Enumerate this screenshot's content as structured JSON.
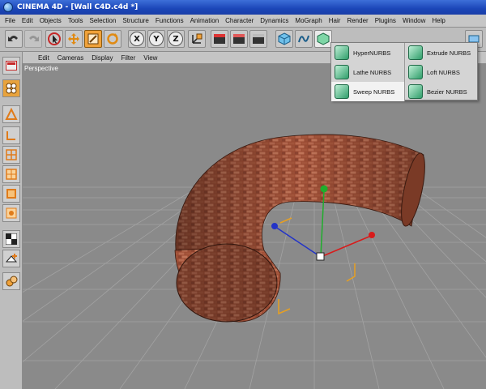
{
  "window": {
    "title": "CINEMA 4D - [Wall C4D.c4d *]"
  },
  "menu": [
    "File",
    "Edit",
    "Objects",
    "Tools",
    "Selection",
    "Structure",
    "Functions",
    "Animation",
    "Character",
    "Dynamics",
    "MoGraph",
    "Hair",
    "Render",
    "Plugins",
    "Window",
    "Help"
  ],
  "toolbar": {
    "icons": [
      "undo-icon",
      "redo-icon",
      "select-icon",
      "move-icon",
      "scale-icon",
      "rotate-icon",
      "x-axis-icon",
      "y-axis-icon",
      "z-axis-icon",
      "coord-system-icon",
      "render-view-icon",
      "render-picture-icon",
      "render-settings-icon",
      "cube-icon",
      "spline-icon",
      "nurbs-icon",
      "deformer-icon"
    ],
    "axis_labels": [
      "X",
      "Y",
      "Z"
    ]
  },
  "view_menu": [
    "Edit",
    "Cameras",
    "Display",
    "Filter",
    "View"
  ],
  "viewport": {
    "label": "Perspective"
  },
  "nurbs_popup": {
    "items": [
      {
        "label": "HyperNURBS",
        "column": "left"
      },
      {
        "label": "Lathe NURBS",
        "column": "left"
      },
      {
        "label": "Sweep NURBS",
        "column": "left",
        "highlighted": true
      },
      {
        "label": "Extrude NURBS",
        "column": "right"
      },
      {
        "label": "Loft NURBS",
        "column": "right"
      },
      {
        "label": "Bezier NURBS",
        "column": "right"
      }
    ]
  },
  "colors": {
    "title_bar": "#1b46b8",
    "active_tool": "#f0a23a",
    "brick": "#9a4a32",
    "grid": "#a3a3a3",
    "x_axis": "#d81b1b",
    "y_axis": "#1fae2c",
    "z_axis": "#2233c8"
  }
}
